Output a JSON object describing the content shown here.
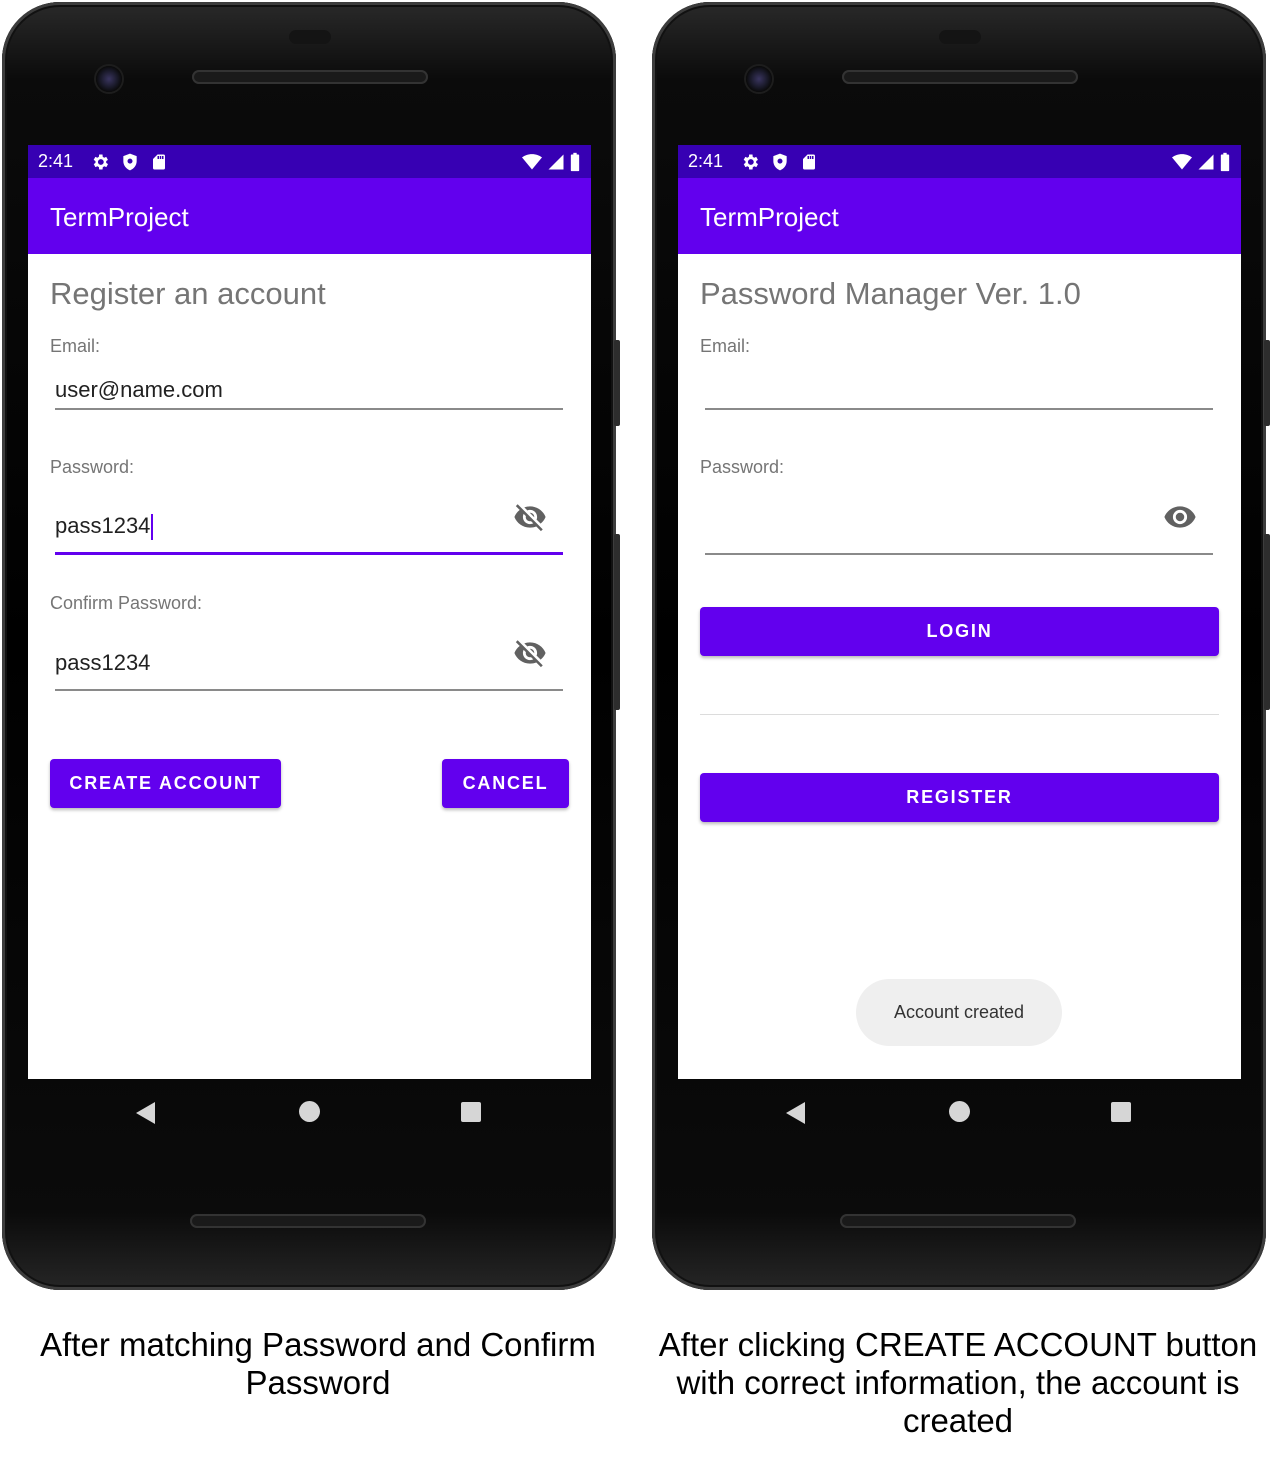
{
  "left_phone": {
    "status_time": "2:41",
    "app_title": "TermProject",
    "heading": "Register an account",
    "email_label": "Email:",
    "email_value": "user@name.com",
    "password_label": "Password:",
    "password_value": "pass1234",
    "confirm_label": "Confirm Password:",
    "confirm_value": "pass1234",
    "create_button": "CREATE ACCOUNT",
    "cancel_button": "CANCEL"
  },
  "right_phone": {
    "status_time": "2:41",
    "app_title": "TermProject",
    "heading": "Password Manager Ver. 1.0",
    "email_label": "Email:",
    "email_value": "",
    "password_label": "Password:",
    "password_value": "",
    "login_button": "LOGIN",
    "register_button": "REGISTER",
    "toast": "Account created"
  },
  "captions": {
    "left": "After matching Password and Confirm Password",
    "right": "After clicking CREATE ACCOUNT button with correct information, the account is created"
  },
  "colors": {
    "primary": "#6200ee",
    "primary_dark": "#3700b3"
  },
  "icons": [
    "settings-icon",
    "shield-icon",
    "sd-card-icon",
    "wifi-icon",
    "signal-icon",
    "battery-icon",
    "eye-off-icon",
    "eye-icon",
    "back-icon",
    "home-icon",
    "recents-icon"
  ]
}
